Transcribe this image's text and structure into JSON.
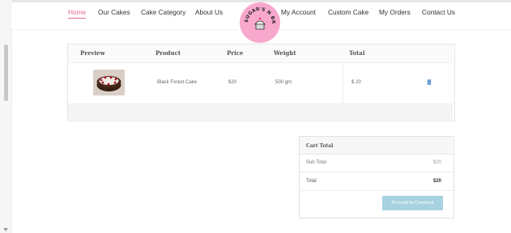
{
  "nav": {
    "home": "Home",
    "our_cakes": "Our Cakes",
    "cake_category": "Cake Category",
    "about_us": "About Us",
    "my_account": "My Account",
    "custom_cake": "Custom Cake",
    "my_orders": "My Orders",
    "contact_us": "Contact Us",
    "active": "home"
  },
  "logo": {
    "text": "SUGAR'S N BROWNIES",
    "color": "#f7a8cc"
  },
  "cart": {
    "headers": {
      "preview": "Preview",
      "product": "Product",
      "price": "Price",
      "weight": "Weight",
      "total": "Total"
    },
    "items": [
      {
        "product": "Black Forest Cake",
        "price": "$20",
        "weight": "500 gm",
        "total": "$ 20",
        "preview_icon": "cake-image",
        "remove_icon": "trash-icon"
      }
    ]
  },
  "totals": {
    "title": "Cart Total",
    "sub_total_label": "Sub Total",
    "sub_total_value": "$20",
    "total_label": "Total",
    "total_value": "$20",
    "checkout_label": "Proceed to Checkout"
  },
  "colors": {
    "accent": "#e86a8f",
    "checkout_button": "#a7d2df",
    "trash_icon": "#3b82c4"
  }
}
